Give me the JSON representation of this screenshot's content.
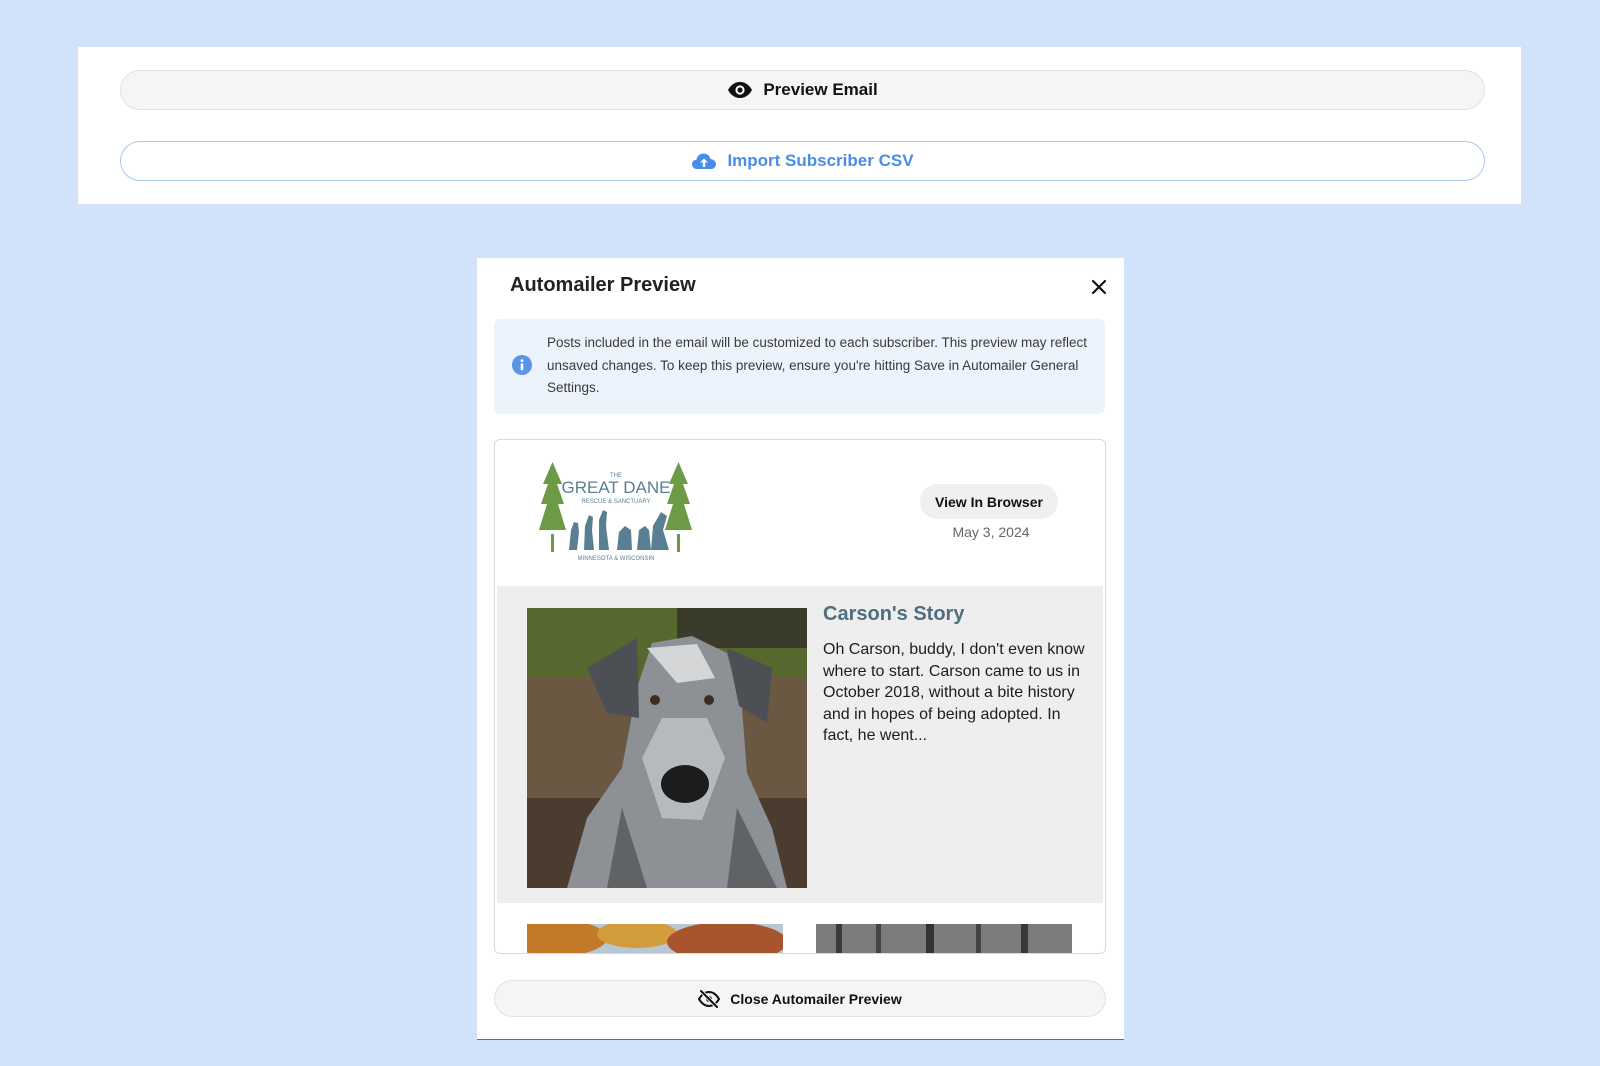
{
  "toolbar": {
    "preview_label": "Preview Email",
    "import_label": "Import Subscriber CSV"
  },
  "modal": {
    "title": "Automailer Preview",
    "info_text": "Posts included in the email will be customized to each subscriber. This preview may reflect unsaved changes. To keep this preview, ensure you're hitting Save in Automailer General Settings.",
    "close_button_label": "Close Automailer Preview"
  },
  "email": {
    "logo": {
      "line_top": "THE",
      "line_main": "GREAT DANE",
      "line_sub": "RESCUE & SANCTUARY",
      "line_bottom": "MINNESOTA & WISCONSIN"
    },
    "view_in_browser": "View In Browser",
    "date": "May 3, 2024",
    "story": {
      "title": "Carson's Story",
      "excerpt": "Oh Carson, buddy, I don't even know where to start. Carson came to us in October 2018, without a bite history and in hopes of being adopted. In fact, he went..."
    }
  },
  "colors": {
    "background": "#d3e2fb",
    "accent_blue": "#4a8de8",
    "story_title": "#4f6e7f",
    "info_bg": "#edf3fd"
  },
  "icons": {
    "preview": "eye-icon",
    "import": "cloud-upload-icon",
    "close": "close-icon",
    "info": "info-icon",
    "close_preview": "eye-off-icon"
  }
}
